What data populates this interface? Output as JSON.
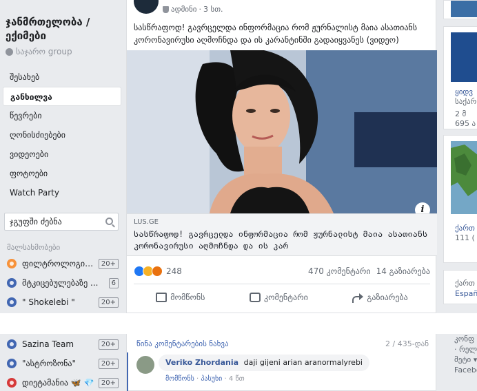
{
  "group": {
    "title": "ჯანმრთელობა / ექიმები",
    "type": "საჯარო group"
  },
  "nav": {
    "items": [
      {
        "label": "შესახებ"
      },
      {
        "label": "განხილვა"
      },
      {
        "label": "წევრები"
      },
      {
        "label": "ღონისძიებები"
      },
      {
        "label": "ვიდეოები"
      },
      {
        "label": "ფოტოები"
      },
      {
        "label": "Watch Party"
      }
    ],
    "active_index": 1
  },
  "search": {
    "placeholder": "ჯგუფში ძებნა"
  },
  "shortcuts": {
    "heading": "მალსახმობები",
    "items": [
      {
        "label": "ფილტროლოგიას/...",
        "badge": "20+",
        "icon_color": "#f7923a"
      },
      {
        "label": "მტკიცებულებაზე ...",
        "badge": "6",
        "icon_color": "#4267b2"
      },
      {
        "label": "\" Shokelebi \"",
        "badge": "20+",
        "icon_color": "#4267b2"
      },
      {
        "label": "Sazina Team",
        "badge": "20+",
        "icon_color": "#4267b2"
      },
      {
        "label": "\"ასტროზონა\"",
        "badge": "20+",
        "icon_color": "#4267b2"
      },
      {
        "label": "დიეტამანია 🦋 💎",
        "badge": "20+",
        "icon_color": "#d63a3a"
      }
    ]
  },
  "post": {
    "author_role": "ადმინი",
    "time": "3 სთ.",
    "text": "სასწრაფოდ! გავრცელდა ინფორმაცია რომ ჟურნალისტ მაია ასათიანს კორონავირუსი აღმოჩნდა და ის კარანტინში გადაიყვანეს (ვიდეო)",
    "link": {
      "domain": "LUS.GE",
      "title": "სასწრაფოდ! გავრცელდა ინფორმაცია რომ ჟურნალისტ მაია ასათიანს კორონავირუსი აღმოჩნდა და ის კარ"
    },
    "reactions": {
      "count": "248",
      "types": [
        "like-icon",
        "haha-icon",
        "angry-icon"
      ]
    },
    "comments_count": "470 კომენტარი",
    "shares_count": "14 გაზიარება",
    "actions": {
      "like": "მომწონს",
      "comment": "კომენტარი",
      "share": "გაზიარება"
    }
  },
  "comments": {
    "previous_label": "წინა კომენტარების ნახვა",
    "counter": "2 / 435-დან",
    "items": [
      {
        "name": "Veriko Zhordania",
        "text": "daji gijeni arian aranormalyrebi",
        "like": "მომწონს",
        "reply": "პასუხი",
        "time": "4 წთ"
      }
    ]
  },
  "right_column": {
    "card1": {
      "line1": "ყიდვ",
      "line2": "საქარ",
      "line3": "2 მ",
      "line4": "695 ა"
    },
    "card2": {
      "line1": "ქართ",
      "line2": "111 ("
    },
    "card3": {
      "line1": "ქართ",
      "line2": "Españ"
    },
    "card4": {
      "line1": "კონფ",
      "line2": "· რელ",
      "line3": "მეტი ▾",
      "line4": "Facebo"
    }
  },
  "colors": {
    "link_blue": "#385898",
    "fb_blue": "#4267b2",
    "background": "#e9ebee"
  }
}
